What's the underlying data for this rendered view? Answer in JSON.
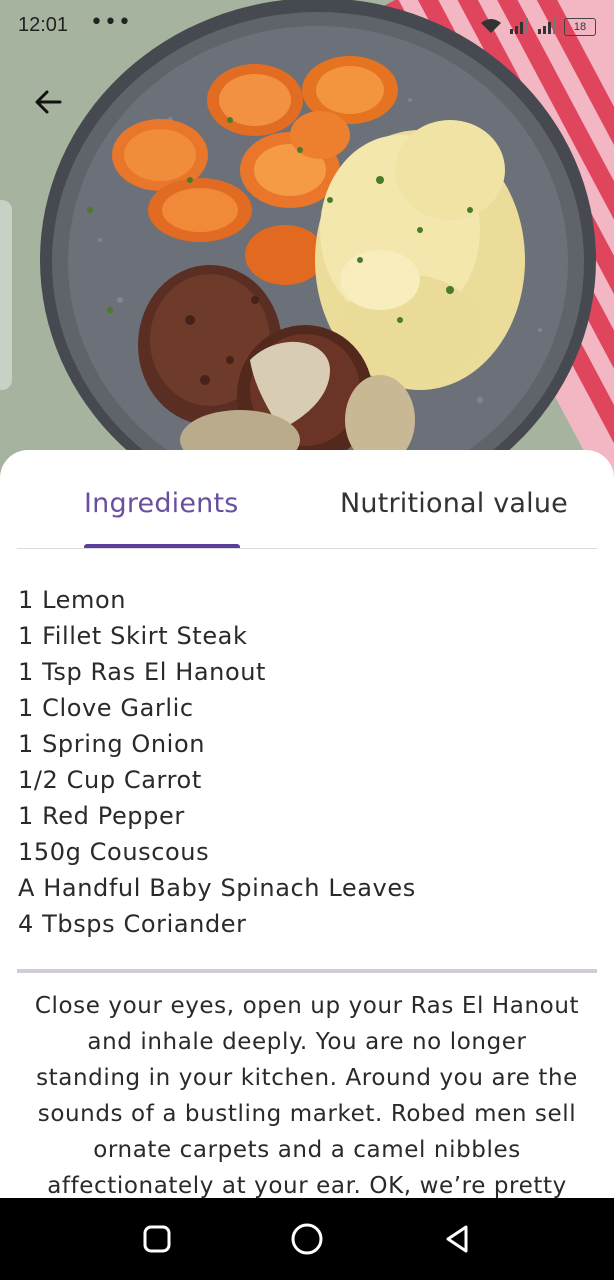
{
  "status_bar": {
    "time": "12:01",
    "more_indicator": "•••",
    "battery": "18"
  },
  "hero": {
    "image": "meatballs-carrots-mash-plate-photo"
  },
  "header": {
    "back_icon": "arrow-back-icon"
  },
  "tabs": [
    {
      "label": "Ingredients",
      "active": true
    },
    {
      "label": "Nutritional value",
      "active": false
    }
  ],
  "ingredients": [
    "1 Lemon",
    "1 Fillet Skirt Steak",
    "1 Tsp Ras El Hanout",
    "1 Clove Garlic",
    "1 Spring Onion",
    "1/2 Cup Carrot",
    "1 Red Pepper",
    "150g Couscous",
    "A Handful Baby Spinach Leaves",
    "4 Tbsps Coriander"
  ],
  "description_lines": [
    "Close your eyes, open up your Ras El Hanout",
    "and inhale deeply. You are no longer",
    "standing in your kitchen. Around you are the",
    "sounds of a bustling market. Robed men sell",
    "ornate carpets and a camel nibbles",
    "affectionately at your ear.  OK, we’re pretty"
  ],
  "nav_bar": {
    "icons": [
      "recents-square-icon",
      "home-circle-icon",
      "back-triangle-icon"
    ]
  },
  "colors": {
    "accent": "#5c3f9a",
    "active_tab_text": "#6a4fa0",
    "divider": "#d3cbdc"
  }
}
